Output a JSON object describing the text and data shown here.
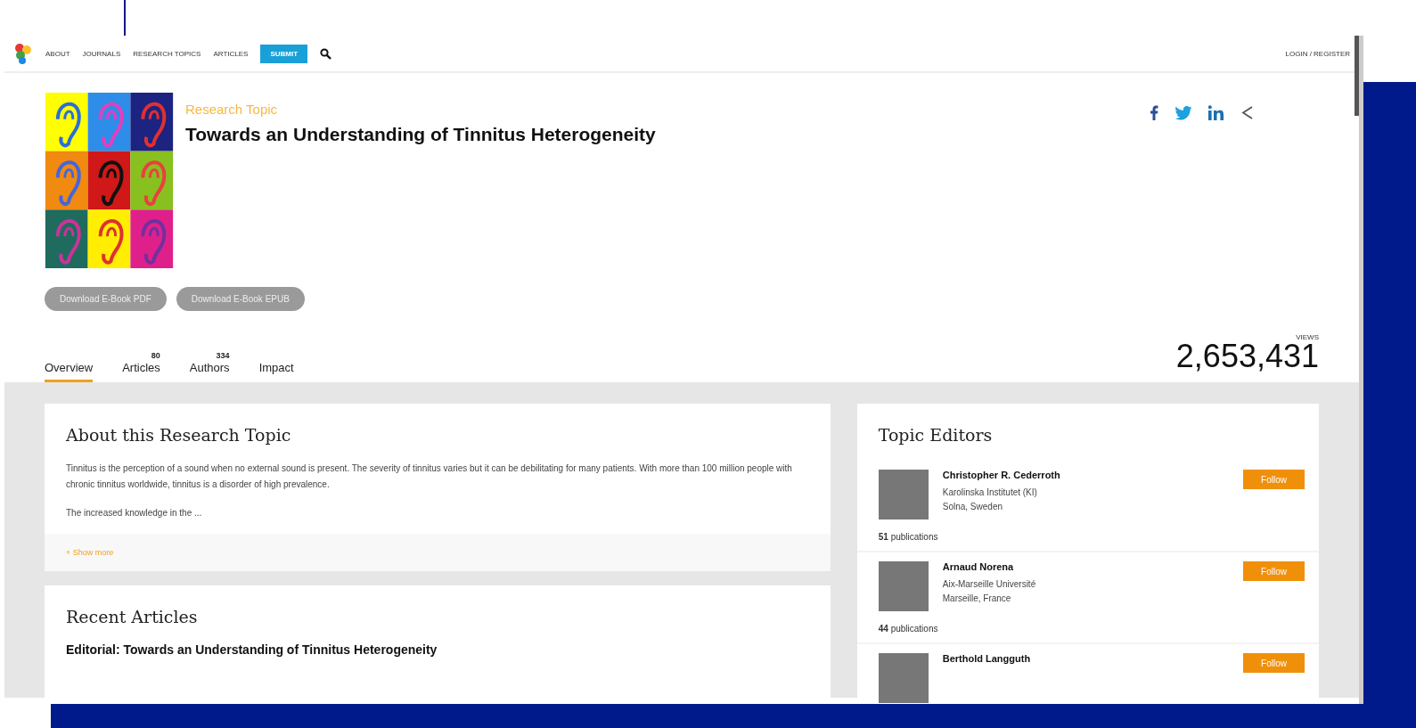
{
  "nav": {
    "items": [
      "ABOUT",
      "JOURNALS",
      "RESEARCH TOPICS",
      "ARTICLES"
    ],
    "submit": "SUBMIT",
    "login": "LOGIN / REGISTER"
  },
  "hero": {
    "kicker": "Research Topic",
    "title": "Towards an Understanding of Tinnitus Heterogeneity",
    "downloads": [
      "Download E-Book PDF",
      "Download E-Book EPUB"
    ]
  },
  "tabs": [
    {
      "label": "Overview",
      "selected": true
    },
    {
      "label": "Articles",
      "count": "80",
      "selected": false
    },
    {
      "label": "Authors",
      "count": "334",
      "selected": false
    },
    {
      "label": "Impact",
      "selected": false
    }
  ],
  "views": {
    "label": "VIEWS",
    "value": "2,653,431"
  },
  "about": {
    "title": "About this Research Topic",
    "paragraphs": [
      "Tinnitus is the perception of a sound when no external sound is present. The severity of tinnitus varies but it can be debilitating for many patients. With more than 100 million people with chronic tinnitus worldwide, tinnitus is a disorder of high prevalence.",
      "The increased knowledge in the ..."
    ],
    "show_more": "+ Show more"
  },
  "recent_articles": {
    "title": "Recent Articles",
    "articles": [
      "Editorial: Towards an Understanding of Tinnitus Heterogeneity"
    ]
  },
  "topic_editors": {
    "title": "Topic Editors",
    "editors": [
      {
        "name": "Christopher R. Cederroth",
        "affiliation": "Karolinska Institutet (KI)",
        "location": "Solna, Sweden",
        "publications": "51",
        "publications_label": "publications",
        "follow": "Follow"
      },
      {
        "name": "Arnaud Norena",
        "affiliation": "Aix-Marseille Université",
        "location": "Marseille, France",
        "publications": "44",
        "publications_label": "publications",
        "follow": "Follow"
      },
      {
        "name": "Berthold Langguth",
        "follow": "Follow"
      }
    ]
  }
}
